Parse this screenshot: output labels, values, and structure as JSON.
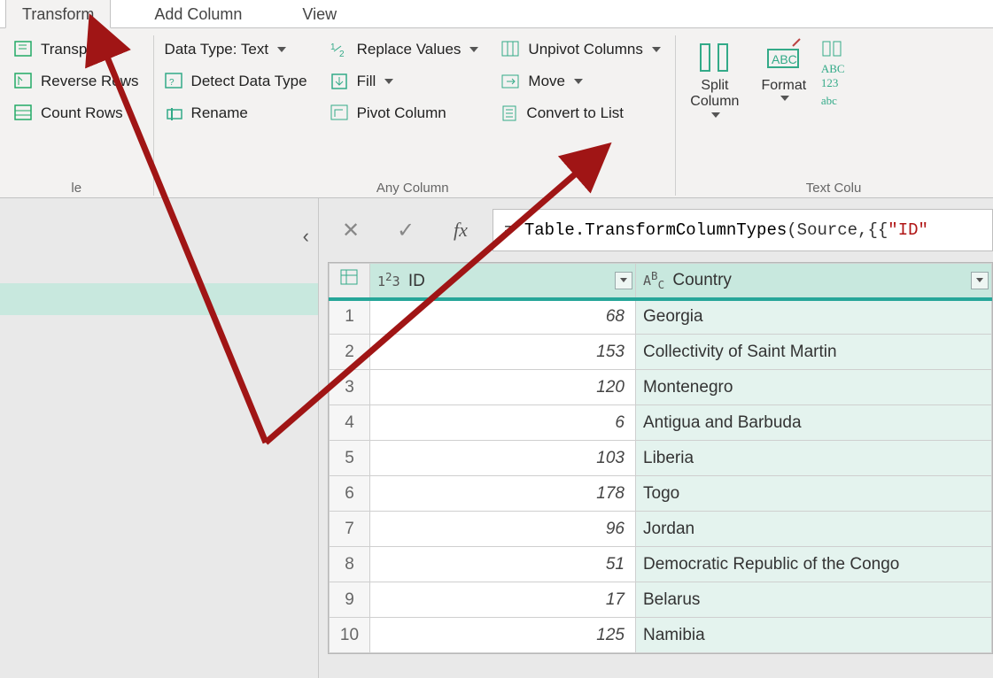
{
  "ribbon_tabs": {
    "transform": "Transform",
    "add_column": "Add Column",
    "view": "View"
  },
  "ribbon": {
    "table_group": {
      "transpose": "Transpose",
      "reverse_rows": "Reverse Rows",
      "count_rows": "Count Rows",
      "label_partial_left": "le"
    },
    "any_column_group": {
      "data_type": "Data Type: Text",
      "detect": "Detect Data Type",
      "rename": "Rename",
      "replace_values": "Replace Values",
      "fill": "Fill",
      "pivot": "Pivot Column",
      "unpivot": "Unpivot Columns",
      "move": "Move",
      "convert_to_list": "Convert to List",
      "label": "Any Column"
    },
    "text_group": {
      "split_column": "Split\nColumn",
      "format": "Format",
      "label_partial": "Text Colu"
    }
  },
  "formula_bar": {
    "prefix": "= ",
    "fn": "Table.TransformColumnTypes",
    "open": "(Source,{{",
    "str": "\"ID\""
  },
  "table": {
    "columns": {
      "id": "ID",
      "country": "Country"
    },
    "rows": [
      {
        "n": "1",
        "id": "68",
        "country": "Georgia"
      },
      {
        "n": "2",
        "id": "153",
        "country": "Collectivity of Saint Martin"
      },
      {
        "n": "3",
        "id": "120",
        "country": "Montenegro"
      },
      {
        "n": "4",
        "id": "6",
        "country": "Antigua and Barbuda"
      },
      {
        "n": "5",
        "id": "103",
        "country": "Liberia"
      },
      {
        "n": "6",
        "id": "178",
        "country": "Togo"
      },
      {
        "n": "7",
        "id": "96",
        "country": "Jordan"
      },
      {
        "n": "8",
        "id": "51",
        "country": "Democratic Republic of the Congo"
      },
      {
        "n": "9",
        "id": "17",
        "country": "Belarus"
      },
      {
        "n": "10",
        "id": "125",
        "country": "Namibia"
      }
    ]
  }
}
